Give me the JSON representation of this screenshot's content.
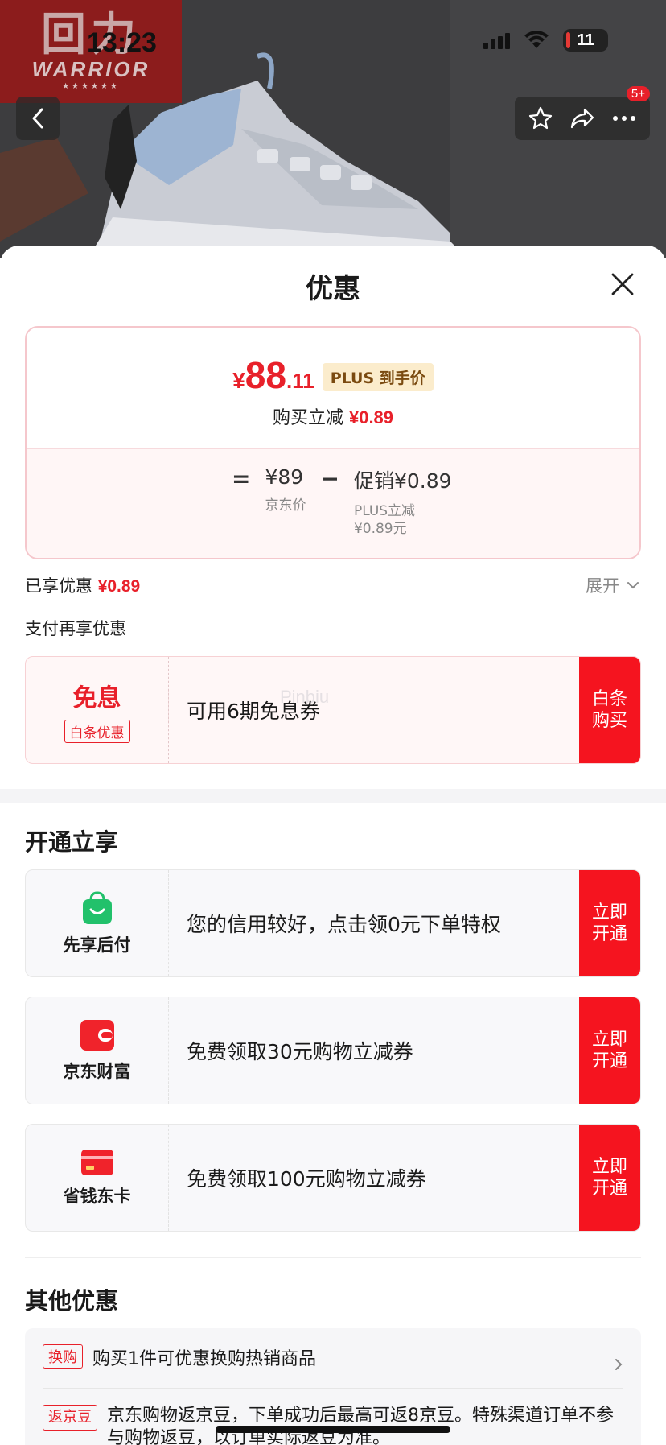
{
  "status_bar": {
    "time": "13:23",
    "battery": "11"
  },
  "brand": {
    "logo_mark": "回力",
    "logo_text": "WARRIOR",
    "logo_stars": "★★★★★★"
  },
  "nav": {
    "badge": "5+"
  },
  "sheet": {
    "title": "优惠"
  },
  "price": {
    "currency": "¥",
    "integer": "88",
    "decimal": ".11",
    "tag": "PLUS 到手价",
    "reduce_label": "购买立减",
    "reduce_value": "¥0.89",
    "formula": {
      "equals": "=",
      "jd_price": "¥89",
      "jd_price_label": "京东价",
      "minus": "−",
      "promo": "促销¥0.89",
      "promo_sub_1": "PLUS立减",
      "promo_sub_2": "¥0.89元"
    }
  },
  "enjoyed": {
    "label": "已享优惠",
    "value": "¥0.89",
    "expand": "展开"
  },
  "pay_more": "支付再享优惠",
  "baitiao": {
    "big": "免息",
    "tag": "白条优惠",
    "text": "可用6期免息券",
    "button_l1": "白条",
    "button_l2": "购买"
  },
  "watermark": "Pinbiu",
  "open_section": {
    "title": "开通立享",
    "items": [
      {
        "name": "先享后付",
        "icon": "shopping-bag-icon",
        "text": "您的信用较好，点击领0元下单特权",
        "button_l1": "立即",
        "button_l2": "开通"
      },
      {
        "name": "京东财富",
        "icon": "wallet-icon",
        "text": "免费领取30元购物立减券",
        "button_l1": "立即",
        "button_l2": "开通"
      },
      {
        "name": "省钱东卡",
        "icon": "card-icon",
        "text": "免费领取100元购物立减券",
        "button_l1": "立即",
        "button_l2": "开通"
      }
    ]
  },
  "other_section": {
    "title": "其他优惠",
    "items": [
      {
        "tag": "换购",
        "text": "购买1件可优惠换购热销商品"
      },
      {
        "tag": "返京豆",
        "text": "京东购物返京豆，下单成功后最高可返8京豆。特殊渠道订单不参与购物返豆，以订单实际返豆为准。"
      }
    ]
  },
  "colors": {
    "accent_red": "#e8202a",
    "button_red": "#f5141f",
    "plus_gold_bg": "#fbeccc"
  }
}
